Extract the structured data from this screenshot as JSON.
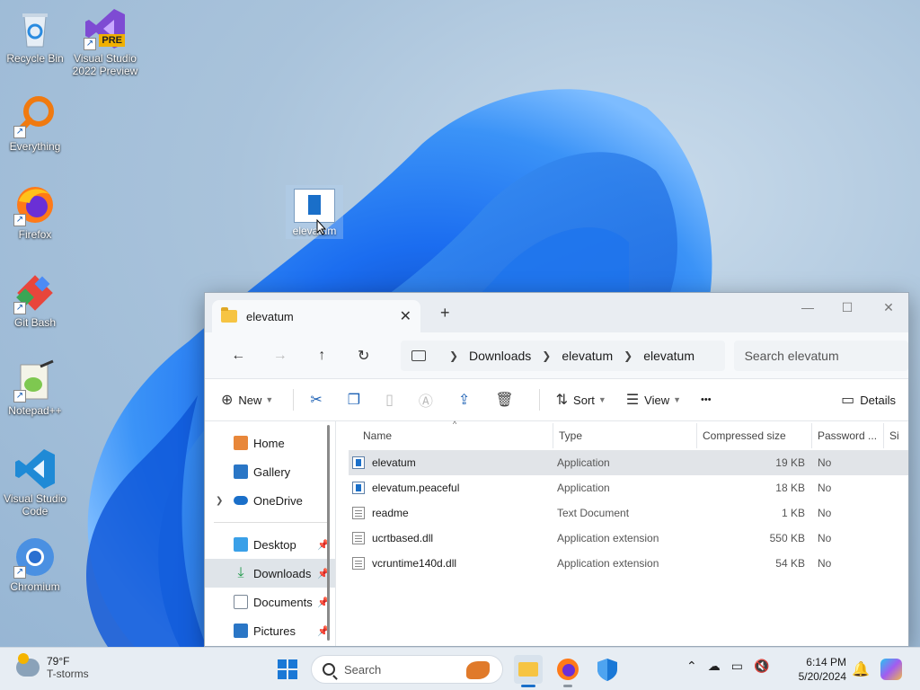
{
  "desktop": {
    "icons": [
      {
        "label": "Recycle Bin",
        "icon": "recycle-bin-icon"
      },
      {
        "label": "Visual Studio 2022 Preview",
        "icon": "visual-studio-preview-icon",
        "badge": "PRE"
      },
      {
        "label": "Everything",
        "icon": "everything-search-icon"
      },
      {
        "label": "Firefox",
        "icon": "firefox-icon"
      },
      {
        "label": "Git Bash",
        "icon": "git-bash-icon"
      },
      {
        "label": "Notepad++",
        "icon": "notepad-plus-plus-icon"
      },
      {
        "label": "Visual Studio Code",
        "icon": "vscode-icon"
      },
      {
        "label": "Chromium",
        "icon": "chromium-icon"
      }
    ],
    "dragged_item": {
      "label": "elevatum",
      "icon": "application-icon"
    }
  },
  "explorer": {
    "tab_title": "elevatum",
    "new_tab": "+",
    "window_controls": {
      "minimize": "—",
      "maximize": "☐",
      "close": "✕"
    },
    "breadcrumb": [
      "Downloads",
      "elevatum",
      "elevatum"
    ],
    "search_placeholder": "Search elevatum",
    "commands": {
      "new": "New",
      "sort": "Sort",
      "view": "View",
      "more": "•••",
      "details": "Details"
    },
    "sidebar": [
      {
        "label": "Home",
        "icon": "home-icon",
        "color": "#e8873a"
      },
      {
        "label": "Gallery",
        "icon": "gallery-icon",
        "color": "#2a76c6"
      },
      {
        "label": "OneDrive",
        "icon": "onedrive-icon",
        "color": "#1a6fc9"
      },
      {
        "label": "Desktop",
        "icon": "desktop-icon",
        "color": "#3aa0e8"
      },
      {
        "label": "Downloads",
        "icon": "downloads-icon",
        "color": "#1f9a4a"
      },
      {
        "label": "Documents",
        "icon": "documents-icon",
        "color": "#7a8796"
      },
      {
        "label": "Pictures",
        "icon": "pictures-icon",
        "color": "#2a76c6"
      }
    ],
    "columns": {
      "name": "Name",
      "type": "Type",
      "compressed_size": "Compressed size",
      "password": "Password ...",
      "size": "Si"
    },
    "files": [
      {
        "name": "elevatum",
        "type": "Application",
        "size": "19 KB",
        "password": "No",
        "icon": "app"
      },
      {
        "name": "elevatum.peaceful",
        "type": "Application",
        "size": "18 KB",
        "password": "No",
        "icon": "app"
      },
      {
        "name": "readme",
        "type": "Text Document",
        "size": "1 KB",
        "password": "No",
        "icon": "doc"
      },
      {
        "name": "ucrtbased.dll",
        "type": "Application extension",
        "size": "550 KB",
        "password": "No",
        "icon": "doc"
      },
      {
        "name": "vcruntime140d.dll",
        "type": "Application extension",
        "size": "54 KB",
        "password": "No",
        "icon": "doc"
      }
    ]
  },
  "taskbar": {
    "weather_temp": "79°F",
    "weather_desc": "T-storms",
    "search_label": "Search",
    "time": "6:14 PM",
    "date": "5/20/2024"
  }
}
